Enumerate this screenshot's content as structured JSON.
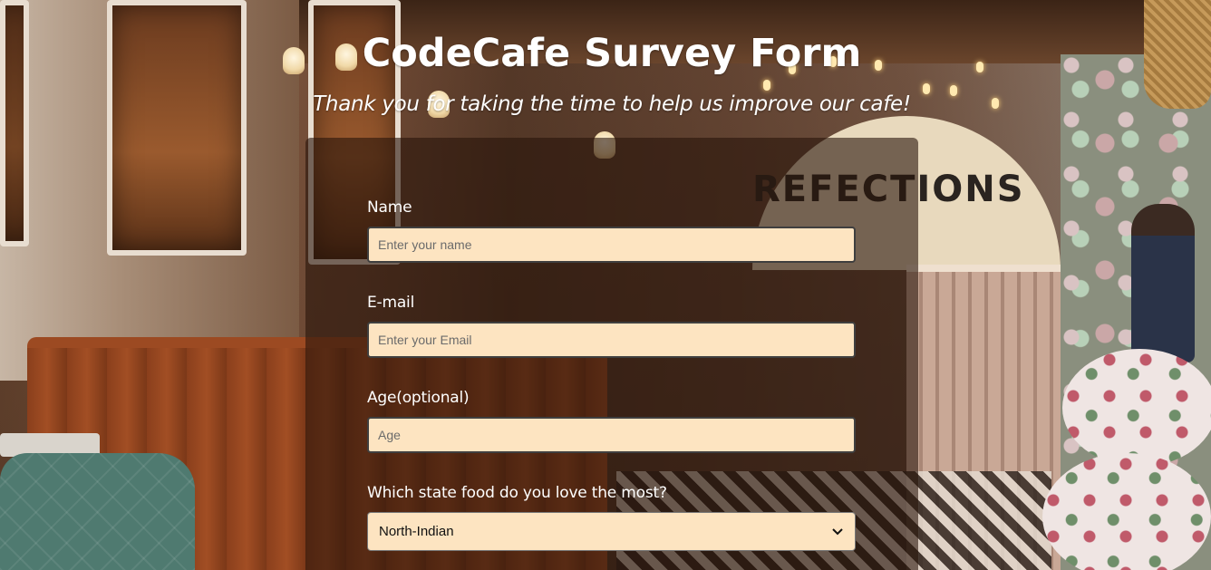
{
  "header": {
    "title": "CodeCafe Survey Form",
    "subtitle": "Thank you for taking the time to help us improve our cafe!"
  },
  "background": {
    "sign_text": "REFECTIONS"
  },
  "form": {
    "name": {
      "label": "Name",
      "placeholder": "Enter your name",
      "value": ""
    },
    "email": {
      "label": "E-mail",
      "placeholder": "Enter your Email",
      "value": ""
    },
    "age": {
      "label": "Age",
      "label_suffix": "(optional)",
      "placeholder": "Age",
      "value": ""
    },
    "state_food": {
      "label": "Which state food do you love the most?",
      "selected": "North-Indian"
    }
  },
  "colors": {
    "input_bg": "#fde4c1",
    "card_overlay": "rgba(40, 20, 10, 0.60)",
    "text": "#ffffff"
  },
  "icons": {
    "select_arrow": "chevron-down-icon"
  }
}
